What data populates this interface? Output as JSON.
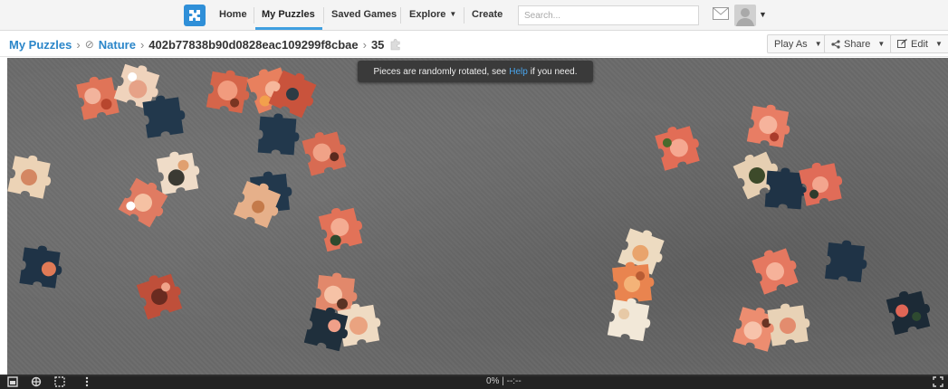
{
  "nav": {
    "items": [
      {
        "label": "Home"
      },
      {
        "label": "My Puzzles"
      },
      {
        "label": "Saved Games"
      },
      {
        "label": "Explore"
      },
      {
        "label": "Create"
      }
    ],
    "search_placeholder": "Search..."
  },
  "breadcrumb": {
    "root": "My Puzzles",
    "category": "Nature",
    "puzzle_id": "402b77838b90d0828eac109299f8cbae",
    "piece_count": "35"
  },
  "toolbar": {
    "play_as": "Play As",
    "share": "Share",
    "edit": "Edit"
  },
  "tooltip": {
    "before": "Pieces are randomly rotated, see",
    "link": "Help",
    "after": "if you need."
  },
  "status": {
    "progress_text": "0%  |  --:--",
    "progress": 0
  },
  "colors": {
    "accent": "#2b86c9",
    "board": "#6a6a6a",
    "tooltip_bg": "#3a3a3a"
  }
}
